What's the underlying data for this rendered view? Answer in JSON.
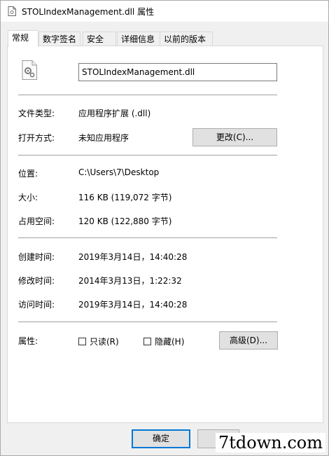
{
  "window": {
    "title": "STOLIndexManagement.dll 属性"
  },
  "tabs": [
    {
      "label": "常规",
      "active": true
    },
    {
      "label": "数字签名"
    },
    {
      "label": "安全"
    },
    {
      "label": "详细信息"
    },
    {
      "label": "以前的版本"
    }
  ],
  "general": {
    "file_name": "STOLIndexManagement.dll",
    "type_label": "文件类型:",
    "type_value": "应用程序扩展 (.dll)",
    "open_with_label": "打开方式:",
    "open_with_value": "未知应用程序",
    "change_button": "更改(C)...",
    "location_label": "位置:",
    "location_value": "C:\\Users\\7\\Desktop",
    "size_label": "大小:",
    "size_value": "116 KB (119,072 字节)",
    "size_on_disk_label": "占用空间:",
    "size_on_disk_value": "120 KB (122,880 字节)",
    "created_label": "创建时间:",
    "created_value": "2019年3月14日，14:40:28",
    "modified_label": "修改时间:",
    "modified_value": "2014年3月13日，1:22:32",
    "accessed_label": "访问时间:",
    "accessed_value": "2019年3月14日，14:40:28",
    "attributes_label": "属性:",
    "readonly_label": "只读(R)",
    "hidden_label": "隐藏(H)",
    "advanced_button": "高级(D)..."
  },
  "footer": {
    "ok_button": "确定",
    "cancel_button_partial": "取"
  },
  "watermark": "7tdown.com",
  "icons": {
    "title_icon": "dll-file-icon",
    "file_icon": "dll-gear-file-icon"
  }
}
